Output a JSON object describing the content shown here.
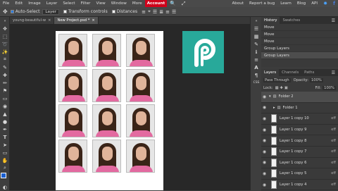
{
  "menubar": {
    "items": [
      "File",
      "Edit",
      "Image",
      "Layer",
      "Select",
      "Filter",
      "View",
      "Window",
      "More"
    ],
    "account_label": "Account",
    "right_items": [
      "About",
      "Report a bug",
      "Learn",
      "Blog",
      "API"
    ]
  },
  "options_bar": {
    "auto_select_label": "Auto-Select",
    "auto_select_value": "Layer",
    "transform_controls_label": "Transform controls",
    "distances_label": "Distances"
  },
  "tabs": [
    {
      "label": "young-beautiful-w"
    },
    {
      "label": "New Project.psd *"
    }
  ],
  "history_panel": {
    "tabs": [
      "History",
      "Swatches"
    ],
    "items": [
      "Move",
      "Move",
      "Move",
      "Group Layers",
      "Group Layers"
    ]
  },
  "layers_panel": {
    "tabs": [
      "Layers",
      "Channels",
      "Paths"
    ],
    "blend_mode": "Pass Through",
    "opacity_label": "Opacity:",
    "opacity_value": "100%",
    "lock_label": "Lock:",
    "fill_label": "Fill:",
    "fill_value": "100%",
    "folders": [
      "Folder 2",
      "Folder 1"
    ],
    "layers": [
      "Layer 1 copy 10",
      "Layer 1 copy 9",
      "Layer 1 copy 8",
      "Layer 1 copy 7",
      "Layer 1 copy 6",
      "Layer 1 copy 5",
      "Layer 1 copy 4"
    ],
    "fx_label": "eff"
  },
  "colors": {
    "account_bg": "#d0021b",
    "logo_bg": "#28a99a",
    "shirt": "#e36aa0"
  }
}
